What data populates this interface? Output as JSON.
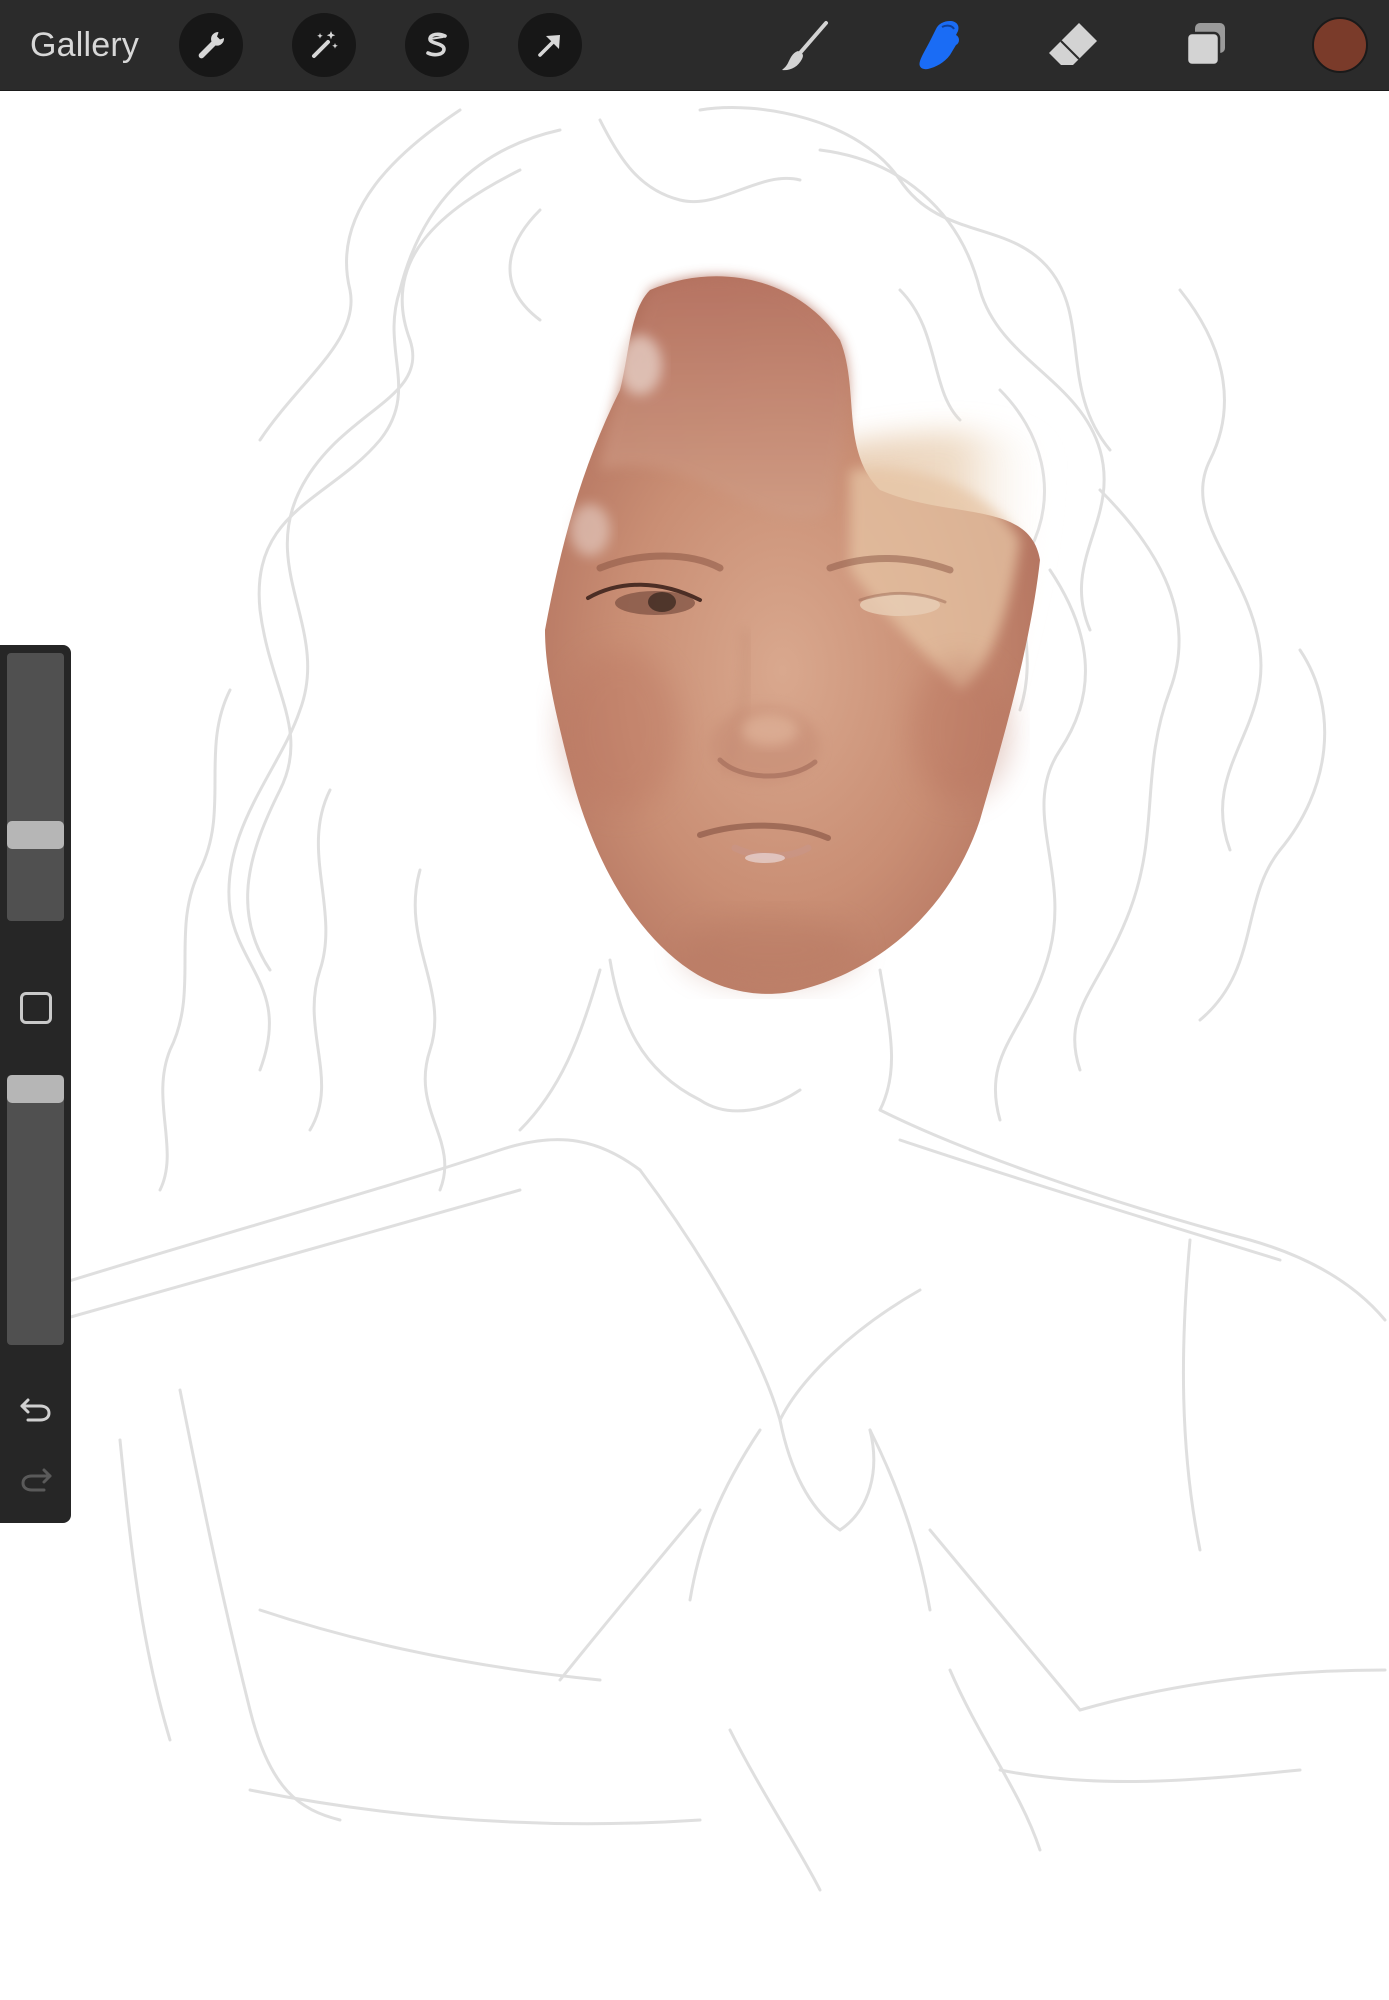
{
  "toolbar": {
    "gallery_label": "Gallery",
    "left_tools": [
      {
        "name": "actions",
        "icon": "wrench-icon"
      },
      {
        "name": "adjustments",
        "icon": "magic-wand-icon"
      },
      {
        "name": "selection",
        "icon": "selection-s-icon"
      },
      {
        "name": "transform",
        "icon": "arrow-cursor-icon"
      }
    ],
    "right_tools": [
      {
        "name": "paint",
        "icon": "brush-icon",
        "active": false
      },
      {
        "name": "smudge",
        "icon": "smudge-finger-icon",
        "active": true
      },
      {
        "name": "erase",
        "icon": "eraser-icon",
        "active": false
      },
      {
        "name": "layers",
        "icon": "layers-icon",
        "active": false
      }
    ],
    "current_color": "#7a3b2a",
    "active_tool_color": "#1a6cf5"
  },
  "sidebar": {
    "brush_size_level": 0.3,
    "brush_opacity_level": 1.0,
    "modify_button_icon": "square-icon",
    "undo_icon": "undo-arrow-icon",
    "redo_icon": "redo-arrow-icon",
    "redo_enabled": false
  },
  "canvas": {
    "background": "#ffffff",
    "sketch_color": "#d9d9d9",
    "skin_colors": [
      "#b57a66",
      "#d29f87",
      "#c6856c",
      "#e8c3a2"
    ]
  }
}
